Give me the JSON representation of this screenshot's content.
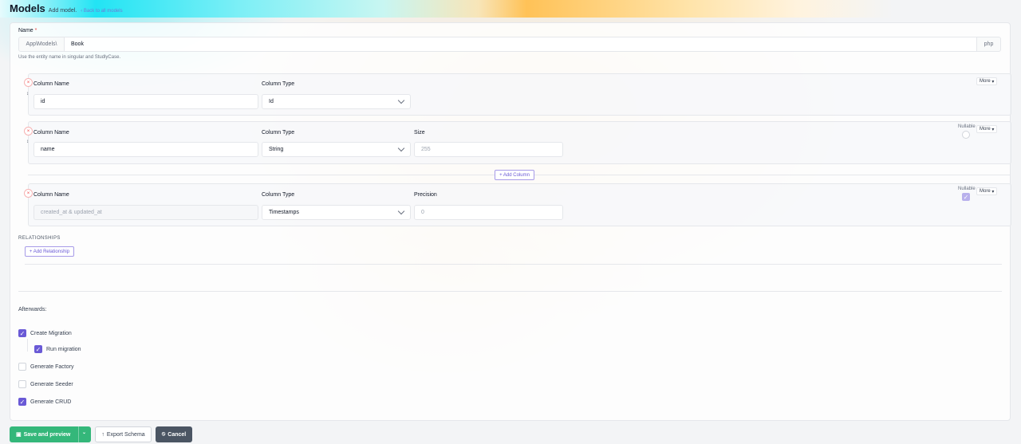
{
  "header": {
    "title": "Models",
    "subtitle": "Add model.",
    "back_link": "Back to all models"
  },
  "name_field": {
    "label": "Name",
    "required_mark": "*",
    "prefix": "App\\Models\\",
    "value": "Book",
    "suffix": "php",
    "help": "Use the entity name in singular and StudlyCase."
  },
  "columns": [
    {
      "name_label": "Column Name",
      "name_value": "id",
      "type_label": "Column Type",
      "type_value": "Id",
      "more": "More"
    },
    {
      "name_label": "Column Name",
      "name_value": "name",
      "type_label": "Column Type",
      "type_value": "String",
      "size_label": "Size",
      "size_placeholder": "255",
      "nullable_label": "Nullable",
      "nullable": false,
      "more": "More"
    },
    {
      "name_label": "Column Name",
      "name_value": "created_at & updated_at",
      "type_label": "Column Type",
      "type_value": "Timestamps",
      "precision_label": "Precision",
      "precision_placeholder": "0",
      "nullable_label": "Nullable",
      "nullable": true,
      "more": "More"
    }
  ],
  "add_column": "+ Add Column",
  "relationships": {
    "heading": "RELATIONSHIPS",
    "add_button": "+ Add Relationship"
  },
  "afterwards": {
    "label": "Afterwards:",
    "options": [
      {
        "label": "Create Migration",
        "checked": true
      },
      {
        "label": "Run migration",
        "checked": true
      },
      {
        "label": "Generate Factory",
        "checked": false
      },
      {
        "label": "Generate Seeder",
        "checked": false
      },
      {
        "label": "Generate CRUD",
        "checked": true
      }
    ]
  },
  "footer": {
    "save": "Save and preview",
    "export": "Export Schema",
    "cancel": "Cancel"
  },
  "colors": {
    "accent": "#6a5ad6",
    "save_button": "#34b77a",
    "cancel_button": "#4b5563"
  }
}
